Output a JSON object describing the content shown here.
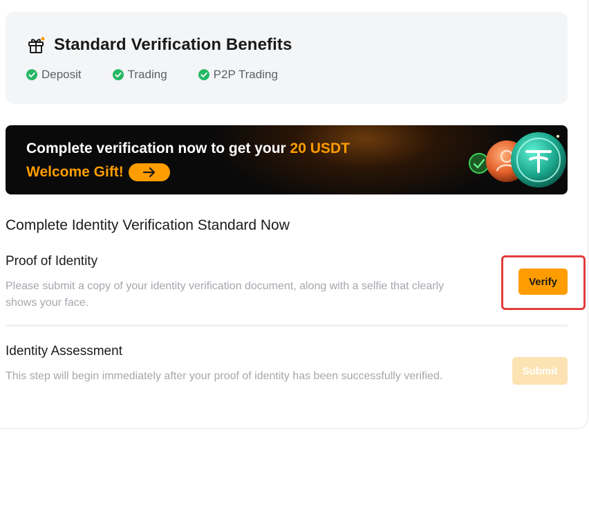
{
  "benefits": {
    "title": "Standard Verification Benefits",
    "icon": "gift-icon",
    "items": [
      {
        "label": "Deposit",
        "icon": "check-circle-icon"
      },
      {
        "label": "Trading",
        "icon": "check-circle-icon"
      },
      {
        "label": "P2P Trading",
        "icon": "check-circle-icon"
      }
    ]
  },
  "banner": {
    "text_prefix": "Complete verification now to get your ",
    "text_highlight": "20 USDT",
    "gift_label": "Welcome Gift!",
    "arrow_icon": "arrow-right-icon"
  },
  "section": {
    "title": "Complete Identity Verification Standard Now"
  },
  "steps": [
    {
      "title": "Proof of Identity",
      "description": "Please submit a copy of your identity verification document, along with a selfie that clearly shows your face.",
      "action_label": "Verify",
      "action_state": "enabled"
    },
    {
      "title": "Identity Assessment",
      "description": "This step will begin immediately after your proof of identity has been successfully verified.",
      "action_label": "Submit",
      "action_state": "disabled"
    }
  ],
  "colors": {
    "accent": "#ff9d00",
    "success": "#25b864",
    "highlight_border": "#e23c3c",
    "disabled_button": "#fde3b3"
  }
}
